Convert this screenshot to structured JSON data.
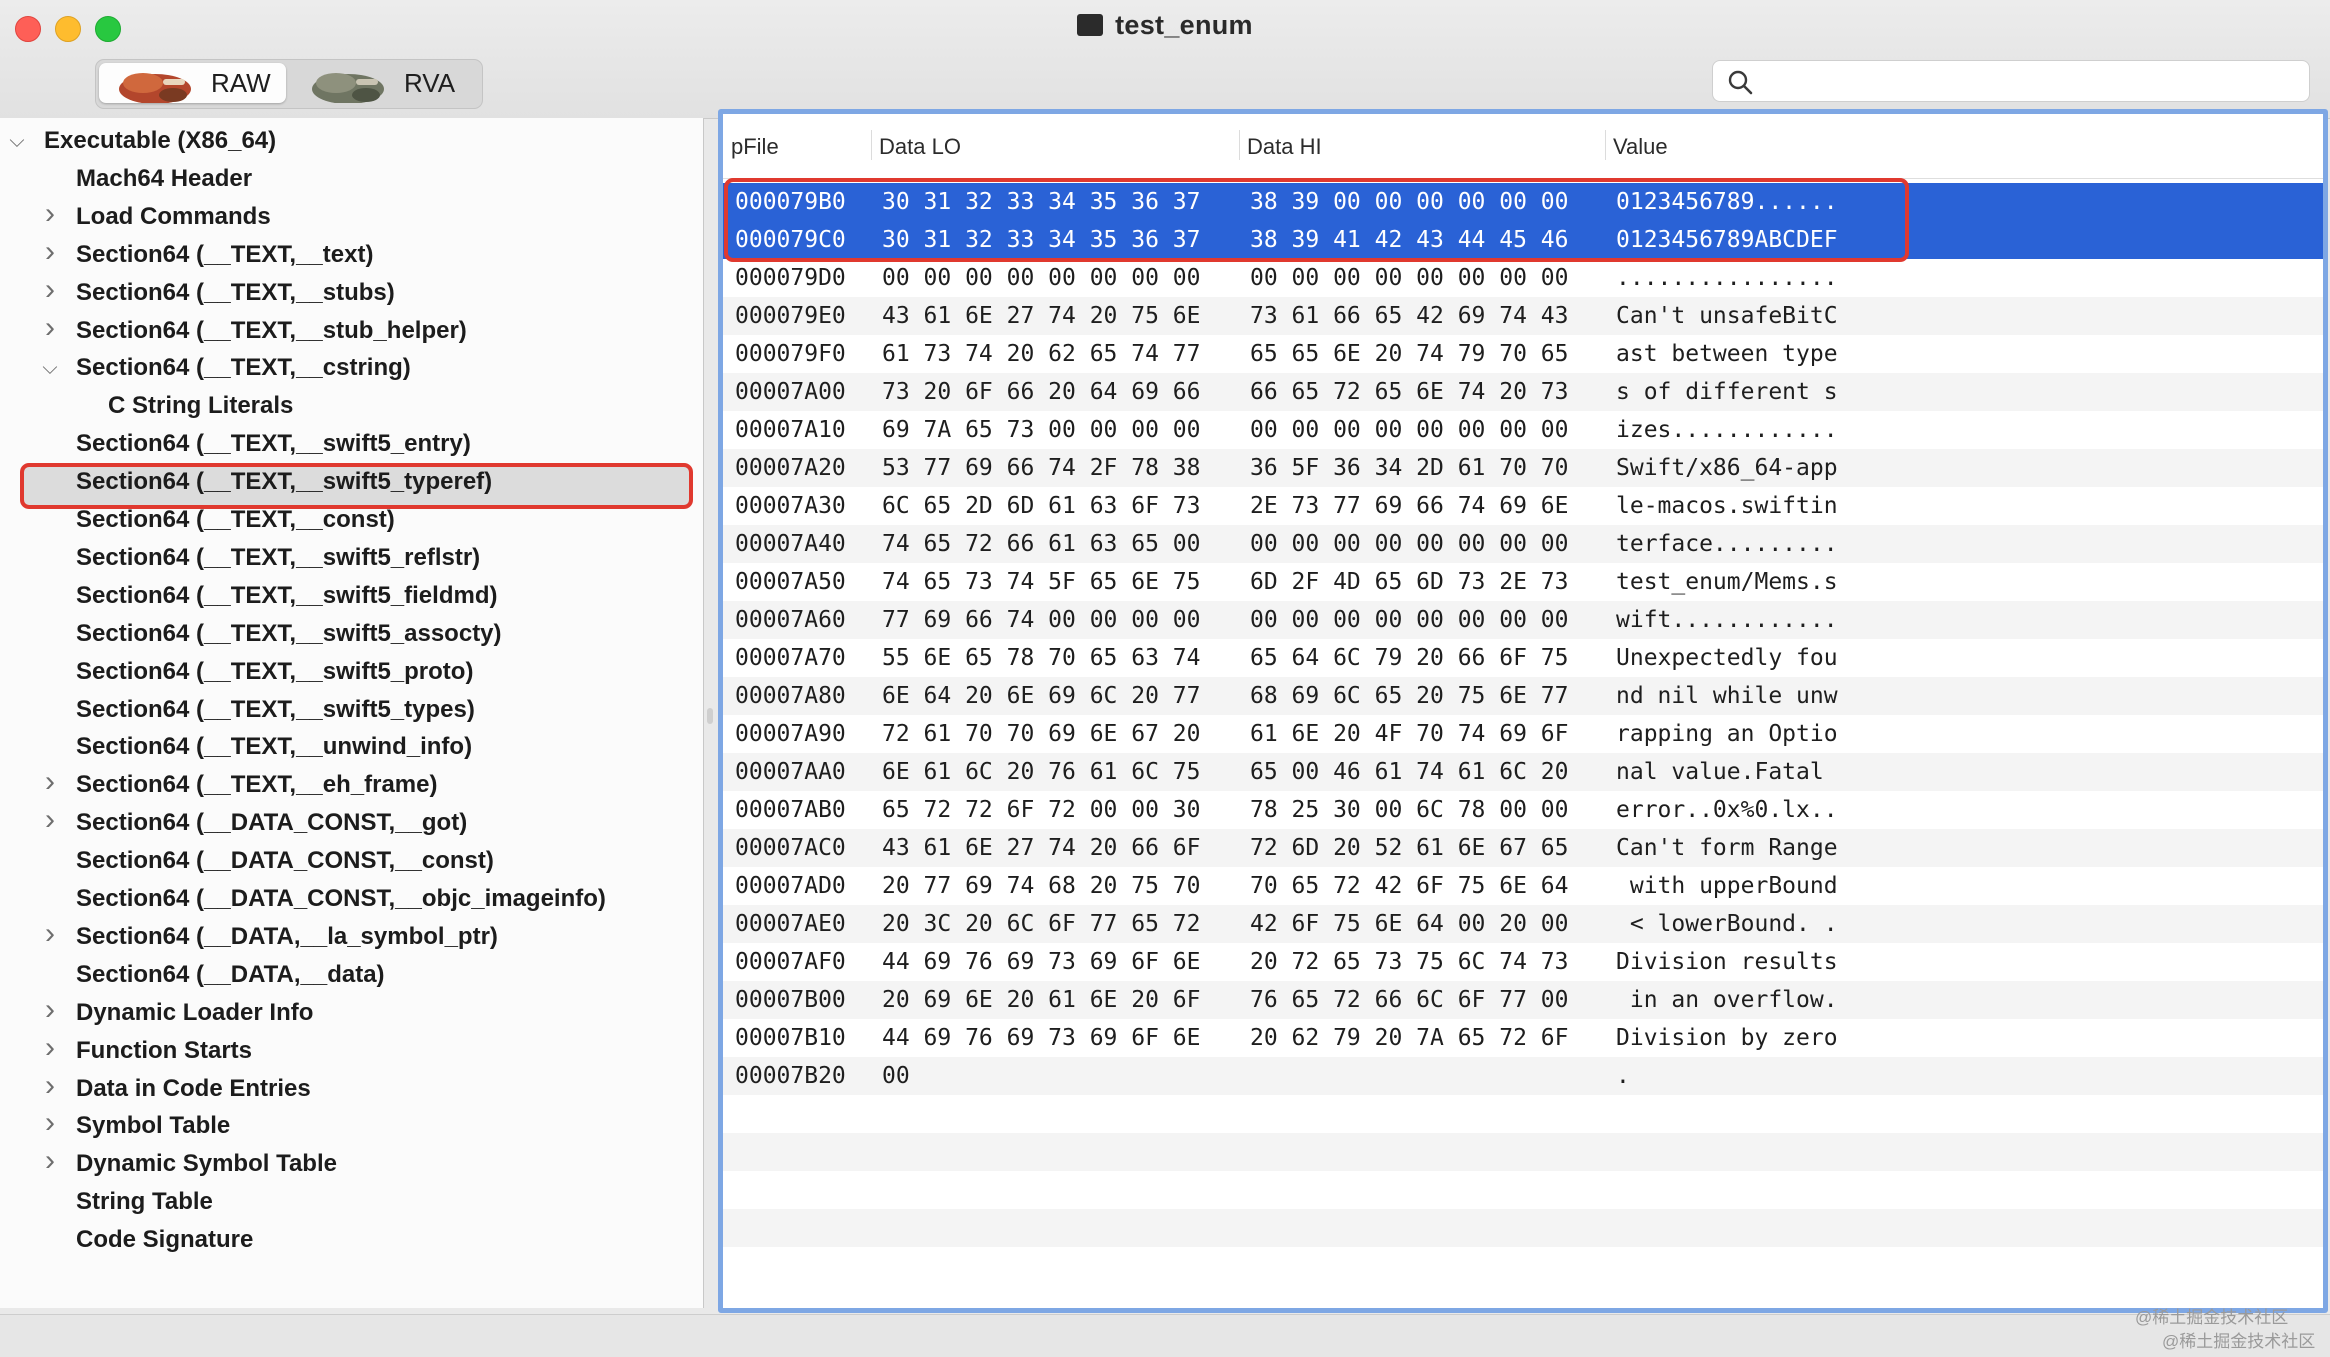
{
  "window": {
    "title": "test_enum",
    "title_icon": "terminal-icon"
  },
  "toolbar": {
    "segments": [
      {
        "label": "RAW",
        "selected": true,
        "icon": "raw-mode-icon"
      },
      {
        "label": "RVA",
        "selected": false,
        "icon": "rva-mode-icon"
      }
    ],
    "search": {
      "placeholder": "",
      "value": "",
      "icon": "search-icon"
    }
  },
  "tree": [
    {
      "label": "Executable  (X86_64)",
      "chevron": "expanded",
      "depth": 0
    },
    {
      "label": "Mach64 Header",
      "chevron": "none",
      "depth": 1
    },
    {
      "label": "Load Commands",
      "chevron": "collapsed",
      "depth": 1
    },
    {
      "label": "Section64 (__TEXT,__text)",
      "chevron": "collapsed",
      "depth": 1
    },
    {
      "label": "Section64 (__TEXT,__stubs)",
      "chevron": "collapsed",
      "depth": 1
    },
    {
      "label": "Section64 (__TEXT,__stub_helper)",
      "chevron": "collapsed",
      "depth": 1
    },
    {
      "label": "Section64 (__TEXT,__cstring)",
      "chevron": "expanded",
      "depth": 1,
      "selected": true
    },
    {
      "label": "C String Literals",
      "chevron": "none",
      "depth": 2
    },
    {
      "label": "Section64 (__TEXT,__swift5_entry)",
      "chevron": "none",
      "depth": 1
    },
    {
      "label": "Section64 (__TEXT,__swift5_typeref)",
      "chevron": "none",
      "depth": 1
    },
    {
      "label": "Section64 (__TEXT,__const)",
      "chevron": "none",
      "depth": 1
    },
    {
      "label": "Section64 (__TEXT,__swift5_reflstr)",
      "chevron": "none",
      "depth": 1
    },
    {
      "label": "Section64 (__TEXT,__swift5_fieldmd)",
      "chevron": "none",
      "depth": 1
    },
    {
      "label": "Section64 (__TEXT,__swift5_assocty)",
      "chevron": "none",
      "depth": 1
    },
    {
      "label": "Section64 (__TEXT,__swift5_proto)",
      "chevron": "none",
      "depth": 1
    },
    {
      "label": "Section64 (__TEXT,__swift5_types)",
      "chevron": "none",
      "depth": 1
    },
    {
      "label": "Section64 (__TEXT,__unwind_info)",
      "chevron": "none",
      "depth": 1
    },
    {
      "label": "Section64 (__TEXT,__eh_frame)",
      "chevron": "collapsed",
      "depth": 1
    },
    {
      "label": "Section64 (__DATA_CONST,__got)",
      "chevron": "collapsed",
      "depth": 1
    },
    {
      "label": "Section64 (__DATA_CONST,__const)",
      "chevron": "none",
      "depth": 1
    },
    {
      "label": "Section64 (__DATA_CONST,__objc_imageinfo)",
      "chevron": "none",
      "depth": 1
    },
    {
      "label": "Section64 (__DATA,__la_symbol_ptr)",
      "chevron": "collapsed",
      "depth": 1
    },
    {
      "label": "Section64 (__DATA,__data)",
      "chevron": "none",
      "depth": 1
    },
    {
      "label": "Dynamic Loader Info",
      "chevron": "collapsed",
      "depth": 1
    },
    {
      "label": "Function Starts",
      "chevron": "collapsed",
      "depth": 1
    },
    {
      "label": "Data in Code Entries",
      "chevron": "collapsed",
      "depth": 1
    },
    {
      "label": "Symbol Table",
      "chevron": "collapsed",
      "depth": 1
    },
    {
      "label": "Dynamic Symbol Table",
      "chevron": "collapsed",
      "depth": 1
    },
    {
      "label": "String Table",
      "chevron": "none",
      "depth": 1
    },
    {
      "label": "Code Signature",
      "chevron": "none",
      "depth": 1
    }
  ],
  "hex_table": {
    "columns": [
      "pFile",
      "Data LO",
      "Data HI",
      "Value"
    ],
    "rows": [
      {
        "pfile": "000079B0",
        "lo": "30 31 32 33 34 35 36 37",
        "hi": "38 39 00 00 00 00 00 00",
        "value": "0123456789......",
        "selected": true
      },
      {
        "pfile": "000079C0",
        "lo": "30 31 32 33 34 35 36 37",
        "hi": "38 39 41 42 43 44 45 46",
        "value": "0123456789ABCDEF",
        "selected": true
      },
      {
        "pfile": "000079D0",
        "lo": "00 00 00 00 00 00 00 00",
        "hi": "00 00 00 00 00 00 00 00",
        "value": "................"
      },
      {
        "pfile": "000079E0",
        "lo": "43 61 6E 27 74 20 75 6E",
        "hi": "73 61 66 65 42 69 74 43",
        "value": "Can't unsafeBitC"
      },
      {
        "pfile": "000079F0",
        "lo": "61 73 74 20 62 65 74 77",
        "hi": "65 65 6E 20 74 79 70 65",
        "value": "ast between type"
      },
      {
        "pfile": "00007A00",
        "lo": "73 20 6F 66 20 64 69 66",
        "hi": "66 65 72 65 6E 74 20 73",
        "value": "s of different s"
      },
      {
        "pfile": "00007A10",
        "lo": "69 7A 65 73 00 00 00 00",
        "hi": "00 00 00 00 00 00 00 00",
        "value": "izes............"
      },
      {
        "pfile": "00007A20",
        "lo": "53 77 69 66 74 2F 78 38",
        "hi": "36 5F 36 34 2D 61 70 70",
        "value": "Swift/x86_64-app"
      },
      {
        "pfile": "00007A30",
        "lo": "6C 65 2D 6D 61 63 6F 73",
        "hi": "2E 73 77 69 66 74 69 6E",
        "value": "le-macos.swiftin"
      },
      {
        "pfile": "00007A40",
        "lo": "74 65 72 66 61 63 65 00",
        "hi": "00 00 00 00 00 00 00 00",
        "value": "terface........."
      },
      {
        "pfile": "00007A50",
        "lo": "74 65 73 74 5F 65 6E 75",
        "hi": "6D 2F 4D 65 6D 73 2E 73",
        "value": "test_enum/Mems.s"
      },
      {
        "pfile": "00007A60",
        "lo": "77 69 66 74 00 00 00 00",
        "hi": "00 00 00 00 00 00 00 00",
        "value": "wift............"
      },
      {
        "pfile": "00007A70",
        "lo": "55 6E 65 78 70 65 63 74",
        "hi": "65 64 6C 79 20 66 6F 75",
        "value": "Unexpectedly fou"
      },
      {
        "pfile": "00007A80",
        "lo": "6E 64 20 6E 69 6C 20 77",
        "hi": "68 69 6C 65 20 75 6E 77",
        "value": "nd nil while unw"
      },
      {
        "pfile": "00007A90",
        "lo": "72 61 70 70 69 6E 67 20",
        "hi": "61 6E 20 4F 70 74 69 6F",
        "value": "rapping an Optio"
      },
      {
        "pfile": "00007AA0",
        "lo": "6E 61 6C 20 76 61 6C 75",
        "hi": "65 00 46 61 74 61 6C 20",
        "value": "nal value.Fatal "
      },
      {
        "pfile": "00007AB0",
        "lo": "65 72 72 6F 72 00 00 30",
        "hi": "78 25 30 00 6C 78 00 00",
        "value": "error..0x%0.lx.."
      },
      {
        "pfile": "00007AC0",
        "lo": "43 61 6E 27 74 20 66 6F",
        "hi": "72 6D 20 52 61 6E 67 65",
        "value": "Can't form Range"
      },
      {
        "pfile": "00007AD0",
        "lo": "20 77 69 74 68 20 75 70",
        "hi": "70 65 72 42 6F 75 6E 64",
        "value": " with upperBound"
      },
      {
        "pfile": "00007AE0",
        "lo": "20 3C 20 6C 6F 77 65 72",
        "hi": "42 6F 75 6E 64 00 20 00",
        "value": " < lowerBound. ."
      },
      {
        "pfile": "00007AF0",
        "lo": "44 69 76 69 73 69 6F 6E",
        "hi": "20 72 65 73 75 6C 74 73",
        "value": "Division results"
      },
      {
        "pfile": "00007B00",
        "lo": "20 69 6E 20 61 6E 20 6F",
        "hi": "76 65 72 66 6C 6F 77 00",
        "value": " in an overflow."
      },
      {
        "pfile": "00007B10",
        "lo": "44 69 76 69 73 69 6F 6E",
        "hi": "20 62 79 20 7A 65 72 6F",
        "value": "Division by zero"
      },
      {
        "pfile": "00007B20",
        "lo": "00",
        "hi": "",
        "value": "."
      }
    ]
  },
  "watermark": {
    "line1": "@稀土掘金技术社区",
    "line2": "@稀土掘金技术社区"
  },
  "colors": {
    "selection_blue": "#2a62d6",
    "highlight_red": "#e0392f",
    "focus_ring": "#7ea7e4"
  }
}
